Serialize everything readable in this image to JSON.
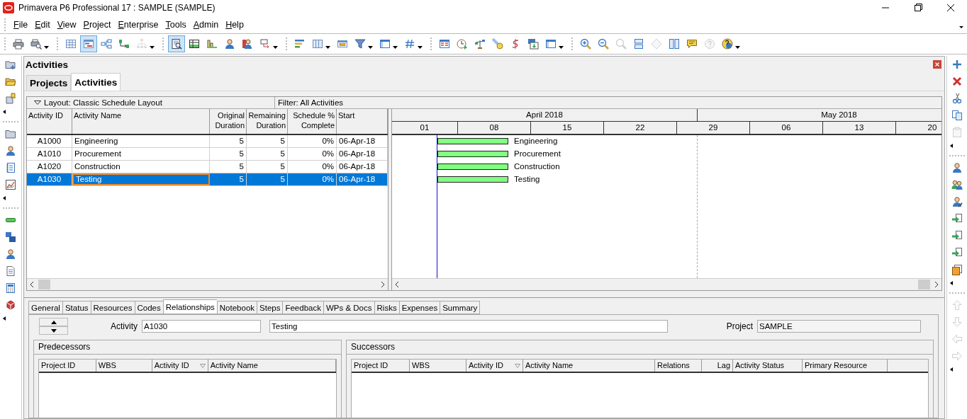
{
  "window": {
    "title": "Primavera P6 Professional 17 : SAMPLE (SAMPLE)"
  },
  "menu": [
    {
      "label": "File"
    },
    {
      "label": "Edit"
    },
    {
      "label": "View"
    },
    {
      "label": "Project"
    },
    {
      "label": "Enterprise"
    },
    {
      "label": "Tools"
    },
    {
      "label": "Admin"
    },
    {
      "label": "Help"
    }
  ],
  "toolbar": [
    [
      {
        "kind": "printer",
        "selected": false,
        "disabled": false,
        "dropdown": false
      },
      {
        "kind": "print_preview",
        "selected": false,
        "disabled": false,
        "dropdown": true
      }
    ],
    [
      {
        "kind": "table",
        "selected": false,
        "disabled": false,
        "dropdown": false
      },
      {
        "kind": "gantt",
        "selected": true,
        "disabled": false,
        "dropdown": false
      },
      {
        "kind": "network",
        "selected": false,
        "disabled": false,
        "dropdown": false
      },
      {
        "kind": "link",
        "selected": false,
        "disabled": false,
        "dropdown": false
      },
      {
        "kind": "hierarchy",
        "selected": false,
        "disabled": true,
        "dropdown": true
      }
    ],
    [
      {
        "kind": "details",
        "selected": true,
        "disabled": false,
        "dropdown": false
      },
      {
        "kind": "green_table",
        "selected": false,
        "disabled": false,
        "dropdown": false
      },
      {
        "kind": "histogram",
        "selected": false,
        "disabled": false,
        "dropdown": false
      },
      {
        "kind": "person",
        "selected": false,
        "disabled": false,
        "dropdown": false
      },
      {
        "kind": "person_red",
        "selected": false,
        "disabled": false,
        "dropdown": false
      },
      {
        "kind": "arrow_box",
        "selected": false,
        "disabled": false,
        "dropdown": true
      }
    ],
    [
      {
        "kind": "bars",
        "selected": false,
        "disabled": false,
        "dropdown": false
      },
      {
        "kind": "columns",
        "selected": false,
        "disabled": false,
        "dropdown": true
      },
      {
        "kind": "bar_box",
        "selected": false,
        "disabled": false,
        "dropdown": false
      },
      {
        "kind": "filter",
        "selected": false,
        "disabled": false,
        "dropdown": true
      },
      {
        "kind": "layout",
        "selected": false,
        "disabled": false,
        "dropdown": true
      },
      {
        "kind": "hash",
        "selected": false,
        "disabled": false,
        "dropdown": true
      }
    ],
    [
      {
        "kind": "report",
        "selected": false,
        "disabled": false,
        "dropdown": false
      },
      {
        "kind": "clock",
        "selected": false,
        "disabled": false,
        "dropdown": false
      },
      {
        "kind": "balance",
        "selected": false,
        "disabled": false,
        "dropdown": false
      },
      {
        "kind": "comet",
        "selected": false,
        "disabled": false,
        "dropdown": false
      },
      {
        "kind": "squiggle",
        "selected": false,
        "disabled": false,
        "dropdown": false
      },
      {
        "kind": "download",
        "selected": false,
        "disabled": false,
        "dropdown": false
      },
      {
        "kind": "layout",
        "selected": false,
        "disabled": false,
        "dropdown": true
      }
    ],
    [
      {
        "kind": "zoom_in",
        "selected": false,
        "disabled": false,
        "dropdown": false
      },
      {
        "kind": "zoom_out",
        "selected": false,
        "disabled": false,
        "dropdown": false
      },
      {
        "kind": "zoom",
        "selected": false,
        "disabled": true,
        "dropdown": false
      },
      {
        "kind": "rows",
        "selected": false,
        "disabled": false,
        "dropdown": false
      },
      {
        "kind": "diamond",
        "selected": false,
        "disabled": true,
        "dropdown": false
      },
      {
        "kind": "split",
        "selected": false,
        "disabled": false,
        "dropdown": false
      },
      {
        "kind": "comment",
        "selected": false,
        "disabled": false,
        "dropdown": false
      },
      {
        "kind": "help",
        "selected": false,
        "disabled": true,
        "dropdown": false
      },
      {
        "kind": "help_globe",
        "selected": false,
        "disabled": false,
        "dropdown": true
      }
    ]
  ],
  "left_sidebar": [
    [
      {
        "kind": "folder_plus",
        "disabled": false
      },
      {
        "kind": "folder_open",
        "disabled": false
      },
      {
        "kind": "doc_star",
        "disabled": false
      }
    ],
    [
      {
        "kind": "folder",
        "disabled": false
      },
      {
        "kind": "person",
        "disabled": false
      },
      {
        "kind": "notebook",
        "disabled": false
      },
      {
        "kind": "chart",
        "disabled": false
      }
    ],
    [
      {
        "kind": "green_bar",
        "disabled": false
      },
      {
        "kind": "blue_boxes",
        "disabled": false
      },
      {
        "kind": "person",
        "disabled": false
      },
      {
        "kind": "document",
        "disabled": false
      },
      {
        "kind": "calculator",
        "disabled": false
      },
      {
        "kind": "dice",
        "disabled": false
      }
    ]
  ],
  "right_sidebar": [
    [
      {
        "kind": "plus",
        "disabled": false
      },
      {
        "kind": "delete",
        "disabled": false
      },
      {
        "kind": "scissors",
        "disabled": false
      },
      {
        "kind": "copy",
        "disabled": false
      },
      {
        "kind": "clipboard",
        "disabled": true
      }
    ],
    [
      {
        "kind": "person",
        "disabled": false
      },
      {
        "kind": "persons",
        "disabled": false
      },
      {
        "kind": "person_pencil",
        "disabled": false
      },
      {
        "kind": "move_doc",
        "disabled": false
      },
      {
        "kind": "move_doc",
        "disabled": false
      },
      {
        "kind": "move_doc",
        "disabled": false
      },
      {
        "kind": "doc_orange",
        "disabled": false
      }
    ],
    [
      {
        "kind": "up",
        "disabled": true
      },
      {
        "kind": "down",
        "disabled": true
      },
      {
        "kind": "left",
        "disabled": true
      },
      {
        "kind": "right",
        "disabled": true
      }
    ]
  ],
  "panel": {
    "title": "Activities"
  },
  "tabs": [
    {
      "label": "Projects",
      "selected": false
    },
    {
      "label": "Activities",
      "selected": true
    }
  ],
  "layout_bar": {
    "layout": "Layout: Classic Schedule Layout",
    "filter": "Filter: All Activities"
  },
  "table": {
    "columns": [
      "Activity ID",
      "Activity Name",
      "Original Duration",
      "Remaining Duration",
      "Schedule % Complete",
      "Start"
    ],
    "rows": [
      {
        "cells": [
          "A1000",
          "Engineering",
          "5",
          "5",
          "0%",
          "06-Apr-18"
        ],
        "selected": false,
        "name_focused": false
      },
      {
        "cells": [
          "A1010",
          "Procurement",
          "5",
          "5",
          "0%",
          "06-Apr-18"
        ],
        "selected": false,
        "name_focused": false
      },
      {
        "cells": [
          "A1020",
          "Construction",
          "5",
          "5",
          "0%",
          "06-Apr-18"
        ],
        "selected": false,
        "name_focused": false
      },
      {
        "cells": [
          "A1030",
          "Testing",
          "5",
          "5",
          "0%",
          "06-Apr-18"
        ],
        "selected": true,
        "name_focused": true
      }
    ]
  },
  "gantt": {
    "months": [
      "April 2018",
      "May 2018"
    ],
    "weeks": [
      "01",
      "08",
      "15",
      "22",
      "29",
      "06",
      "13",
      "20"
    ],
    "bars": [
      {
        "label": "Engineering"
      },
      {
        "label": "Procurement"
      },
      {
        "label": "Construction"
      },
      {
        "label": "Testing"
      }
    ]
  },
  "detail_tabs": [
    {
      "label": "General",
      "selected": false
    },
    {
      "label": "Status",
      "selected": false
    },
    {
      "label": "Resources",
      "selected": false
    },
    {
      "label": "Codes",
      "selected": false
    },
    {
      "label": "Relationships",
      "selected": true
    },
    {
      "label": "Notebook",
      "selected": false
    },
    {
      "label": "Steps",
      "selected": false
    },
    {
      "label": "Feedback",
      "selected": false
    },
    {
      "label": "WPs & Docs",
      "selected": false
    },
    {
      "label": "Risks",
      "selected": false
    },
    {
      "label": "Expenses",
      "selected": false
    },
    {
      "label": "Summary",
      "selected": false
    }
  ],
  "activity": {
    "label": "Activity",
    "id": "A1030",
    "name": "Testing"
  },
  "project": {
    "label": "Project",
    "value": "SAMPLE"
  },
  "predecessors": {
    "title": "Predecessors",
    "columns": [
      {
        "label": "Project ID",
        "sorted": false
      },
      {
        "label": "WBS",
        "sorted": false
      },
      {
        "label": "Activity ID",
        "sorted": true
      },
      {
        "label": "Activity Name",
        "sorted": false
      }
    ]
  },
  "successors": {
    "title": "Successors",
    "columns": [
      {
        "label": "Project ID",
        "sorted": false
      },
      {
        "label": "WBS",
        "sorted": false
      },
      {
        "label": "Activity ID",
        "sorted": true
      },
      {
        "label": "Activity Name",
        "sorted": false
      },
      {
        "label": "Relations",
        "sorted": false
      },
      {
        "label": "Lag",
        "sorted": false
      },
      {
        "label": "Activity Status",
        "sorted": false
      },
      {
        "label": "Primary Resource",
        "sorted": false
      }
    ]
  }
}
